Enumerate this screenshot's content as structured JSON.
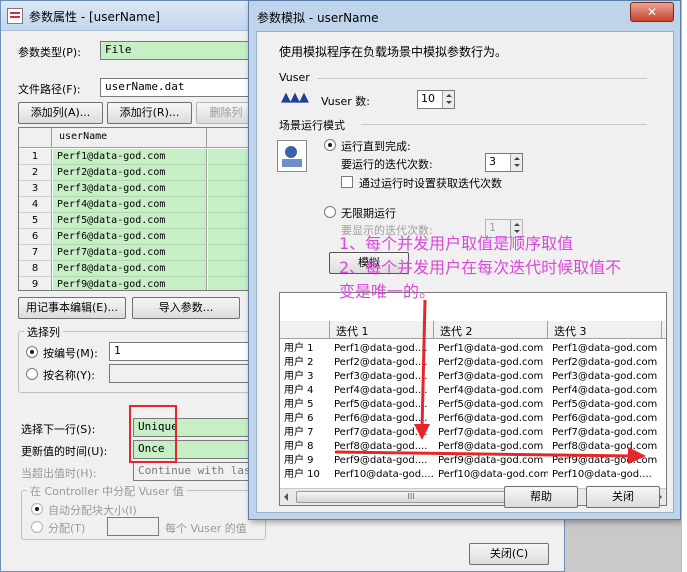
{
  "back_window": {
    "title": "参数属性 - [userName]",
    "param_type_label": "参数类型(P):",
    "param_type_value": "File",
    "file_path_label": "文件路径(F):",
    "file_path_value": "userName.dat",
    "add_column_button": "添加列(A)...",
    "add_row_button": "添加行(R)...",
    "delete_column_button": "删除列",
    "grid_column": "userName",
    "grid_rows": [
      {
        "n": "1",
        "v": "Perf1@data-god.com"
      },
      {
        "n": "2",
        "v": "Perf2@data-god.com"
      },
      {
        "n": "3",
        "v": "Perf3@data-god.com"
      },
      {
        "n": "4",
        "v": "Perf4@data-god.com"
      },
      {
        "n": "5",
        "v": "Perf5@data-god.com"
      },
      {
        "n": "6",
        "v": "Perf6@data-god.com"
      },
      {
        "n": "7",
        "v": "Perf7@data-god.com"
      },
      {
        "n": "8",
        "v": "Perf8@data-god.com"
      },
      {
        "n": "9",
        "v": "Perf9@data-god.com"
      }
    ],
    "notepad_button": "用记事本编辑(E)...",
    "import_button": "导入参数...",
    "select_column_group": "选择列",
    "by_number_label": "按编号(M):",
    "by_number_value": "1",
    "by_name_label": "按名称(Y):",
    "select_next_row_label": "选择下一行(S):",
    "select_next_row_value": "Unique",
    "update_value_label": "更新值的时间(U):",
    "update_value_value": "Once",
    "when_out_label": "当超出值时(H):",
    "when_out_value": "Continue with last",
    "vuser_alloc_group": "在 Controller 中分配 Vuser 值",
    "auto_alloc_label": "自动分配块大小(I)",
    "alloc_label": "分配(T)",
    "per_vuser_label": "每个 Vuser 的值",
    "close_button": "关闭(C)"
  },
  "front_window": {
    "title": "参数模拟 - userName",
    "close_x": "✕",
    "description": "使用模拟程序在负载场景中模拟参数行为。",
    "vuser_section": "Vuser",
    "vuser_count_label": "Vuser 数:",
    "vuser_count_value": "10",
    "run_mode_section": "场景运行模式",
    "run_until_done_label": "运行直到完成:",
    "iterations_label": "要运行的迭代次数:",
    "iterations_value": "3",
    "runtime_checkbox_label": "通过运行时设置获取迭代次数",
    "infinite_label": "无限期运行",
    "display_iterations_label": "要显示的迭代次数:",
    "display_iterations_value": "1",
    "simulate_button": "模拟",
    "grid_headers": [
      "",
      "迭代 1",
      "迭代 2",
      "迭代 3"
    ],
    "grid_rows": [
      [
        "用户 1",
        "Perf1@data-god....",
        "Perf1@data-god.com",
        "Perf1@data-god.com"
      ],
      [
        "用户 2",
        "Perf2@data-god....",
        "Perf2@data-god.com",
        "Perf2@data-god.com"
      ],
      [
        "用户 3",
        "Perf3@data-god....",
        "Perf3@data-god.com",
        "Perf3@data-god.com"
      ],
      [
        "用户 4",
        "Perf4@data-god....",
        "Perf4@data-god.com",
        "Perf4@data-god.com"
      ],
      [
        "用户 5",
        "Perf5@data-god....",
        "Perf5@data-god.com",
        "Perf5@data-god.com"
      ],
      [
        "用户 6",
        "Perf6@data-god....",
        "Perf6@data-god.com",
        "Perf6@data-god.com"
      ],
      [
        "用户 7",
        "Perf7@data-god....",
        "Perf7@data-god.com",
        "Perf7@data-god.com"
      ],
      [
        "用户 8",
        "Perf8@data-god....",
        "Perf8@data-god.com",
        "Perf8@data-god.com"
      ],
      [
        "用户 9",
        "Perf9@data-god....",
        "Perf9@data-god.com",
        "Perf9@data-god.com"
      ],
      [
        "用户 10",
        "Perf10@data-god....",
        "Perf10@data-god.com",
        "Perf10@data-god...."
      ]
    ],
    "scroll_thumb": "III",
    "help_button": "帮助",
    "close_button": "关闭"
  },
  "annotations": {
    "line1": "1、每个并发用户取值是顺序取值",
    "line2": "2、每个并发用户在每次迭代时候取值不",
    "line3": "变是唯一的。"
  },
  "colors": {
    "grid_green": "#c6efc6",
    "annotation": "#d84ad8",
    "highlight_red": "#e8262a"
  }
}
